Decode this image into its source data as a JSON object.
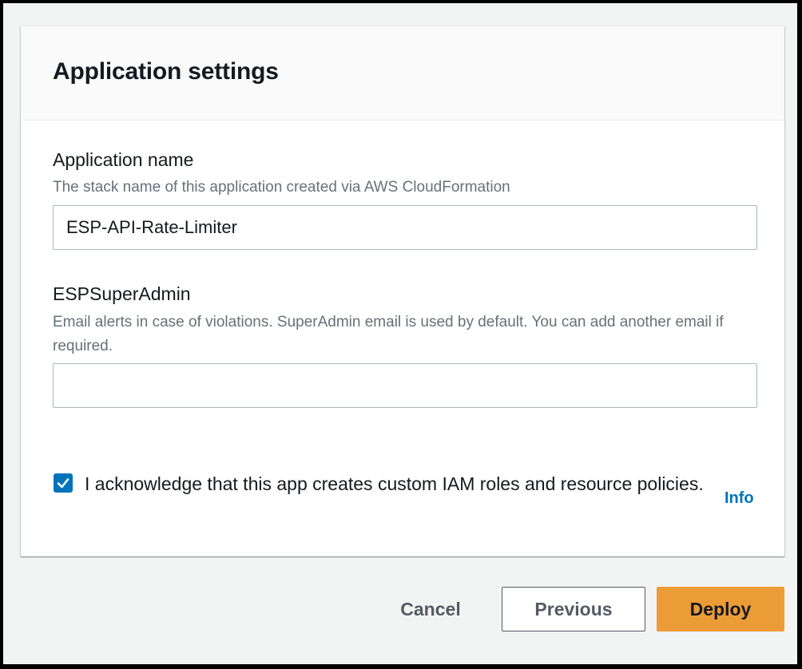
{
  "panel": {
    "title": "Application settings"
  },
  "fields": {
    "app_name": {
      "label": "Application name",
      "description": "The stack name of this application created via AWS CloudFormation",
      "value": "ESP-API-Rate-Limiter"
    },
    "super_admin": {
      "label": "ESPSuperAdmin",
      "description": "Email alerts in case of violations. SuperAdmin email is used by default. You can add another email if required.",
      "value": ""
    }
  },
  "acknowledge": {
    "checked": true,
    "text": "I acknowledge that this app creates custom IAM roles and resource policies.",
    "info_label": "Info"
  },
  "actions": {
    "cancel_label": "Cancel",
    "previous_label": "Previous",
    "deploy_label": "Deploy"
  },
  "colors": {
    "accent": "#0073bb",
    "primary_button": "#ec9c36",
    "background": "#f2f3f3"
  },
  "icons": {
    "checkbox": "checkmark-icon"
  }
}
